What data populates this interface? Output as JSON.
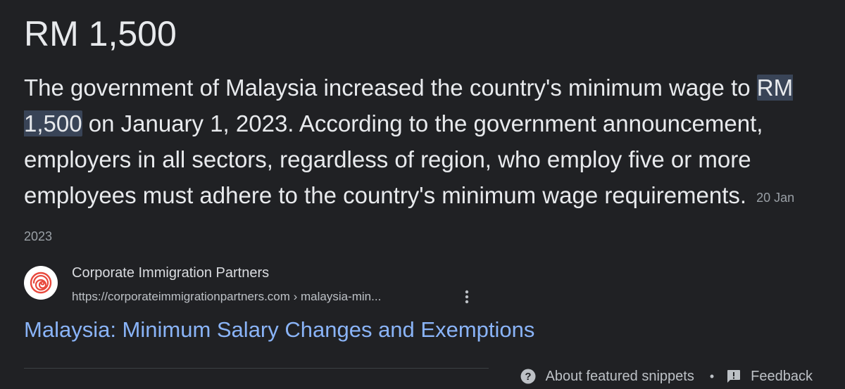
{
  "answer": {
    "title": "RM 1,500",
    "text_before": "The government of Malaysia increased the country's minimum wage to ",
    "highlight": "RM 1,500",
    "text_after": " on January 1, 2023. According to the government announcement, employers in all sectors, regardless of region, who employ five or more employees must adhere to the country's minimum wage requirements.",
    "date": "20 Jan 2023"
  },
  "source": {
    "name": "Corporate Immigration Partners",
    "url": "https://corporateimmigrationpartners.com › malaysia-min...",
    "favicon_icon": "spiral-logo-icon",
    "more_icon": "more-vert-icon"
  },
  "result": {
    "title": "Malaysia: Minimum Salary Changes and Exemptions"
  },
  "footer": {
    "about_label": "About featured snippets",
    "separator": "•",
    "feedback_label": "Feedback",
    "about_icon": "help-circle-icon",
    "feedback_icon": "feedback-icon"
  },
  "colors": {
    "background": "#202124",
    "text": "#e8eaed",
    "link": "#8ab4f8",
    "highlight": "#394457",
    "muted": "#9aa0a6",
    "brand_red": "#e8483c"
  }
}
